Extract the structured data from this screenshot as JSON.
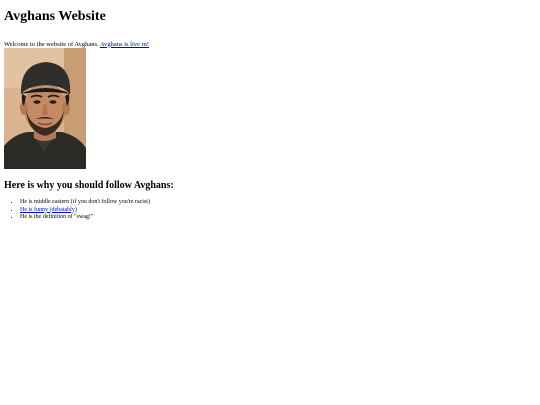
{
  "header": {
    "title": "Avghans Website"
  },
  "intro": {
    "text": "Welcome to the website of Avghans. ",
    "link_label": "Avghans is live rn!"
  },
  "photo": {
    "description_icon": "portrait-photo"
  },
  "section": {
    "title": "Here is why you should follow Avghans:"
  },
  "reasons": [
    {
      "text": "He is middle eastern (if you don't follow you're racist)",
      "is_link": false
    },
    {
      "text": "He is funny (debatably)",
      "is_link": true
    },
    {
      "text": "He is the definition of \"swag!\"",
      "is_link": false
    }
  ],
  "colors": {
    "link": "#0000ee",
    "text": "#000000",
    "background": "#ffffff"
  }
}
